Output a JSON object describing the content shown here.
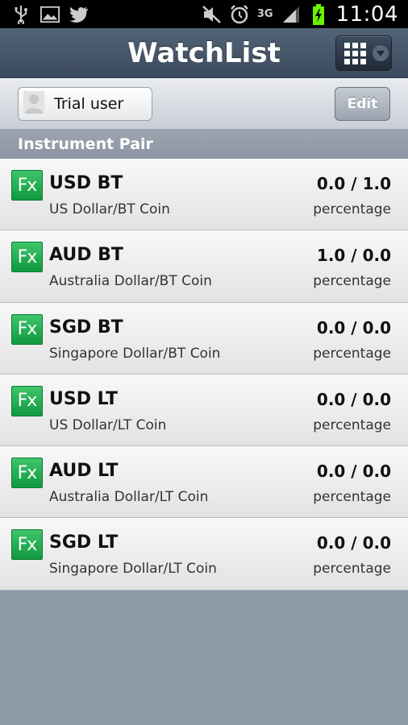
{
  "status_bar": {
    "time": "11:04",
    "network": "3G",
    "icons": [
      "usb-icon",
      "image-icon",
      "twitter-icon",
      "mute-icon",
      "alarm-icon",
      "signal-icon",
      "battery-charging-icon"
    ]
  },
  "header": {
    "title": "WatchList",
    "menu_icon": "grid-menu-icon"
  },
  "toolbar": {
    "user_label": "Trial user",
    "edit_label": "Edit"
  },
  "list": {
    "section_header": "Instrument Pair",
    "badge": "Fx",
    "items": [
      {
        "symbol": "USD BT",
        "description": "US Dollar/BT Coin",
        "value": "0.0 / 1.0",
        "unit": "percentage"
      },
      {
        "symbol": "AUD BT",
        "description": "Australia Dollar/BT Coin",
        "value": "1.0 / 0.0",
        "unit": "percentage"
      },
      {
        "symbol": "SGD BT",
        "description": "Singapore Dollar/BT Coin",
        "value": "0.0 / 0.0",
        "unit": "percentage"
      },
      {
        "symbol": "USD LT",
        "description": "US Dollar/LT Coin",
        "value": "0.0 / 0.0",
        "unit": "percentage"
      },
      {
        "symbol": "AUD LT",
        "description": "Australia Dollar/LT Coin",
        "value": "0.0 / 0.0",
        "unit": "percentage"
      },
      {
        "symbol": "SGD LT",
        "description": "Singapore Dollar/LT Coin",
        "value": "0.0 / 0.0",
        "unit": "percentage"
      }
    ]
  },
  "colors": {
    "fx_badge": "#22aa4d",
    "title_bar": "#4a596d",
    "background": "#8e99a8"
  }
}
